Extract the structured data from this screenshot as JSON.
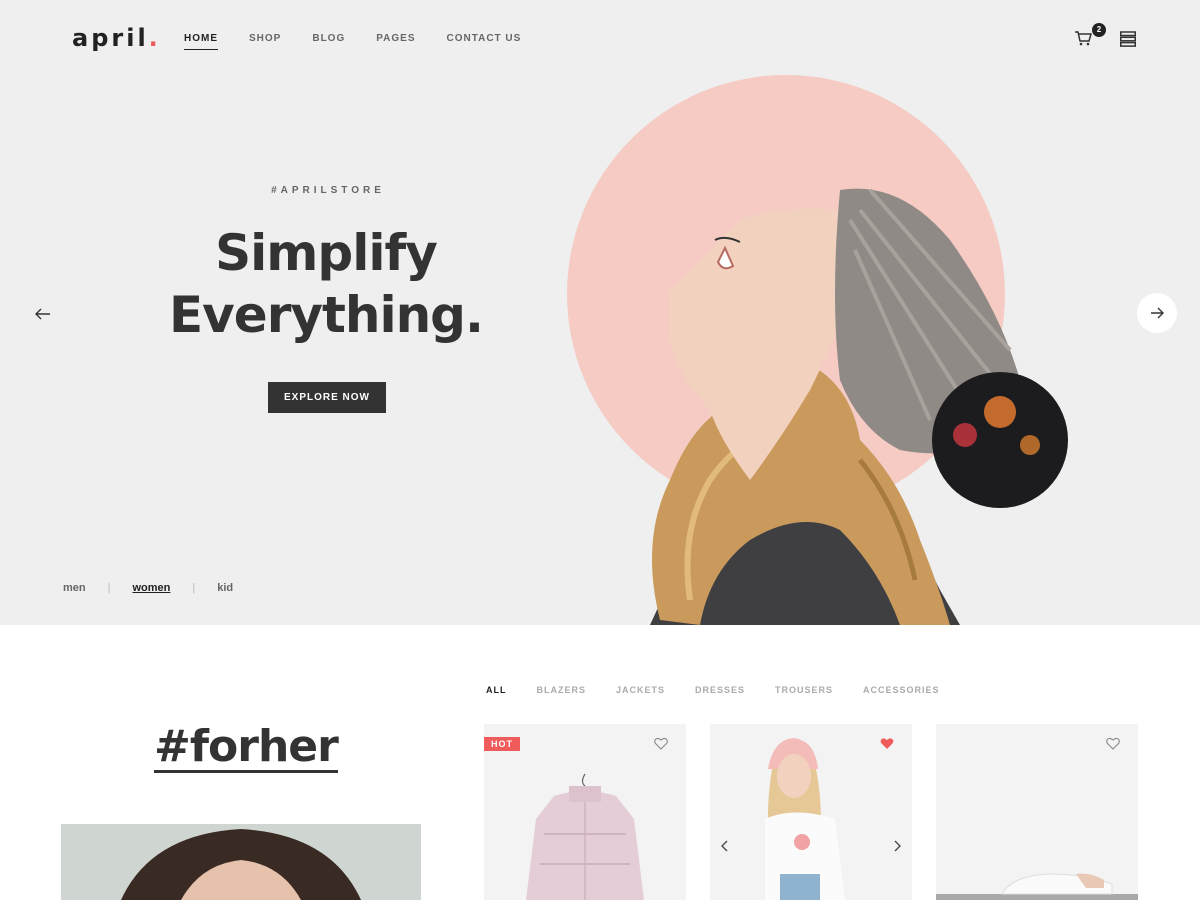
{
  "brand": {
    "name": "april",
    "dot": ".",
    "accent_color": "#ef5b5b"
  },
  "nav": {
    "items": [
      {
        "label": "HOME",
        "active": true
      },
      {
        "label": "SHOP",
        "active": false
      },
      {
        "label": "BLOG",
        "active": false
      },
      {
        "label": "PAGES",
        "active": false
      },
      {
        "label": "CONTACT US",
        "active": false
      }
    ]
  },
  "header": {
    "cart_icon": "cart-icon",
    "cart_count": "2",
    "menu_icon": "stacked-menu-icon"
  },
  "hero": {
    "hashtag": "#APRILSTORE",
    "headline_line1": "Simplify",
    "headline_line2": "Everything.",
    "cta_label": "EXPLORE NOW",
    "prev_icon": "arrow-left-icon",
    "next_icon": "arrow-right-icon",
    "circle_color": "#f5cbc4",
    "gender_tabs": [
      {
        "label": "men",
        "active": false
      },
      {
        "label": "women",
        "active": true
      },
      {
        "label": "kid",
        "active": false
      }
    ],
    "separator": "|"
  },
  "collection": {
    "title": "#forher"
  },
  "filters": {
    "items": [
      {
        "label": "ALL",
        "active": true
      },
      {
        "label": "BLAZERS",
        "active": false
      },
      {
        "label": "JACKETS",
        "active": false
      },
      {
        "label": "DRESSES",
        "active": false
      },
      {
        "label": "TROUSERS",
        "active": false
      },
      {
        "label": "ACCESSORIES",
        "active": false
      }
    ]
  },
  "products": [
    {
      "badge": "HOT",
      "wishlisted": false,
      "image": "pink-puffer-jacket"
    },
    {
      "badge": "",
      "wishlisted": true,
      "image": "girl-in-pink-cap"
    },
    {
      "badge": "",
      "wishlisted": false,
      "image": "white-sneakers"
    }
  ]
}
